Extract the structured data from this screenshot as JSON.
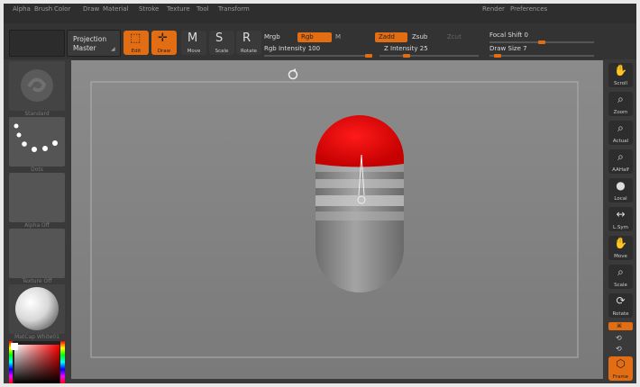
{
  "menu": [
    "Alpha",
    "Brush",
    "Color",
    "Draw",
    "Material",
    "Stroke",
    "Texture",
    "Tool",
    "Transform",
    "Render",
    "Preferences"
  ],
  "toolbar": {
    "projection_master": [
      "Projection",
      "Master"
    ],
    "tools": [
      {
        "label": "Edit",
        "icon": "edit-icon",
        "active": true
      },
      {
        "label": "Draw",
        "icon": "draw-icon",
        "active": true
      },
      {
        "label": "Move",
        "icon": "move-icon",
        "active": false
      },
      {
        "label": "Scale",
        "icon": "scale-icon",
        "active": false
      },
      {
        "label": "Rotate",
        "icon": "rotate-icon",
        "active": false
      }
    ],
    "mrgb": "Mrgb",
    "rgb": "Rgb",
    "m": "M",
    "rgb_intensity_label": "Rgb Intensity",
    "rgb_intensity_value": "100",
    "rgb_intensity_fraction": 1.0,
    "zadd": "Zadd",
    "zsub": "Zsub",
    "zcut": "Zcut",
    "z_intensity_label": "Z Intensity",
    "z_intensity_value": "25",
    "z_intensity_fraction": 0.25,
    "focal_shift_label": "Focal Shift",
    "focal_shift_value": "0",
    "focal_shift_fraction": 0.5,
    "draw_size_label": "Draw Size",
    "draw_size_value": "7",
    "draw_size_fraction": 0.05
  },
  "left_tray": [
    {
      "label": "Standard",
      "icon": "standard-brush-icon"
    },
    {
      "label": "Dots",
      "icon": "dots-stroke-icon"
    },
    {
      "label": "Alpha Off",
      "icon": "alpha-icon"
    },
    {
      "label": "Texture Off",
      "icon": "texture-icon"
    },
    {
      "label": "MatCap White01",
      "icon": "matcap-sphere-icon"
    }
  ],
  "right_tray": [
    {
      "label": "Scroll",
      "icon": "scroll-hand-icon",
      "active": false
    },
    {
      "label": "Zoom",
      "icon": "zoom-icon",
      "active": false
    },
    {
      "label": "Actual",
      "icon": "actual-icon",
      "active": false
    },
    {
      "label": "AAHalf",
      "icon": "aahalf-icon",
      "active": false
    },
    {
      "label": "Local",
      "icon": "local-icon",
      "active": false
    },
    {
      "label": "L.Sym",
      "icon": "lsym-icon",
      "active": false
    },
    {
      "label": "Move",
      "icon": "move-hand-icon",
      "active": false
    },
    {
      "label": "Scale",
      "icon": "scale-zoom-icon",
      "active": false
    },
    {
      "label": "Rotate",
      "icon": "rotate-icon",
      "active": false
    },
    {
      "label": "Frame",
      "icon": "frame-cube-icon",
      "active": true
    }
  ],
  "colors": {
    "accent": "#e36d12",
    "red_cap": "#e00000",
    "body_gray": "#8c8c8c"
  }
}
